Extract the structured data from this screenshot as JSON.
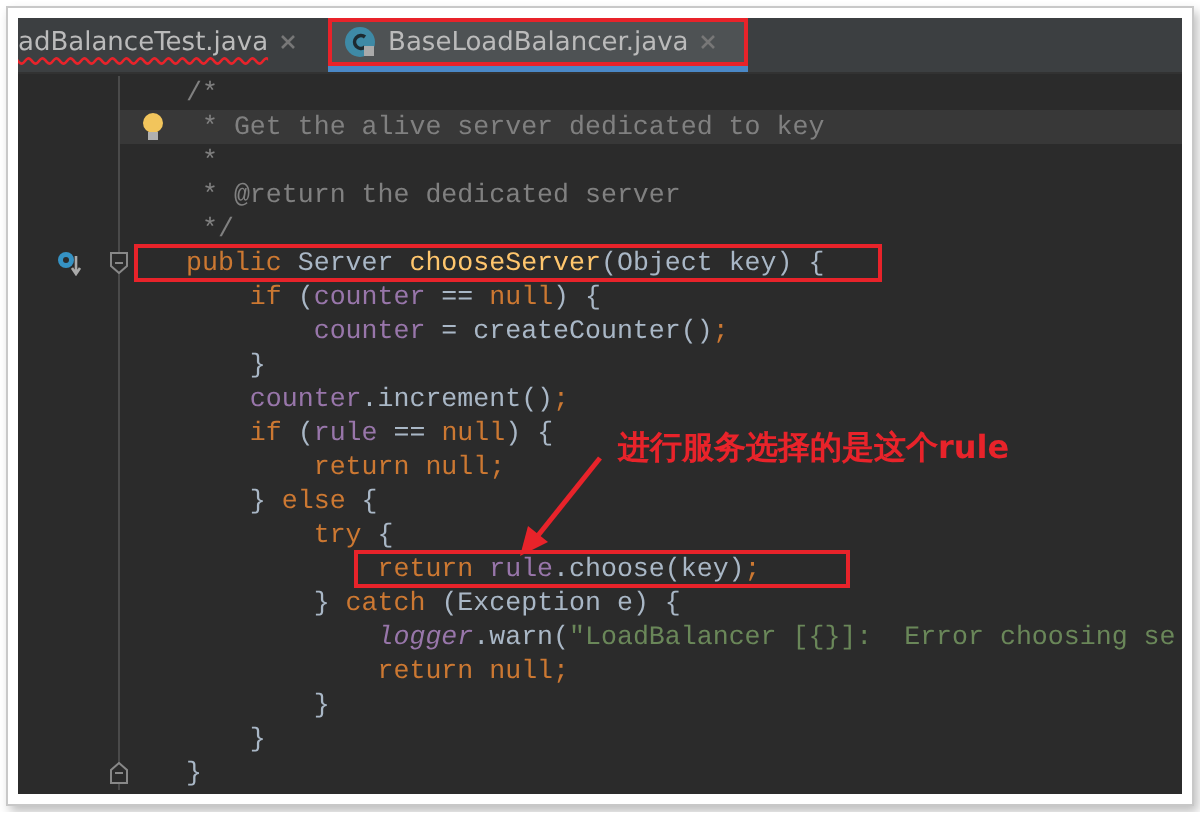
{
  "tabs": [
    {
      "label": "adBalanceTest.java",
      "selected": false,
      "error": true,
      "boxed": false
    },
    {
      "label": "BaseLoadBalancer.java",
      "selected": true,
      "error": false,
      "boxed": true
    }
  ],
  "code": [
    {
      "current": false,
      "boxed": false,
      "tokens": [
        {
          "kind": "comment",
          "text": "/*"
        }
      ]
    },
    {
      "icons": [
        {
          "kind": "bulb"
        }
      ],
      "current": true,
      "boxed": false,
      "tokens": [
        {
          "kind": "comment",
          "text": " * Get the alive server dedicated to key"
        }
      ]
    },
    {
      "current": false,
      "boxed": false,
      "tokens": [
        {
          "kind": "comment",
          "text": " *"
        }
      ]
    },
    {
      "current": false,
      "boxed": false,
      "tokens": [
        {
          "kind": "comment",
          "text": " * @return the dedicated server"
        }
      ]
    },
    {
      "current": false,
      "boxed": false,
      "tokens": [
        {
          "kind": "comment",
          "text": " */"
        }
      ]
    },
    {
      "icons": [
        {
          "kind": "override"
        },
        {
          "kind": "fold_start"
        }
      ],
      "current": false,
      "boxed": true,
      "tokens": [
        {
          "kind": "keyword",
          "text": "public "
        },
        {
          "kind": "plain",
          "text": "Server "
        },
        {
          "kind": "method",
          "text": "chooseServer"
        },
        {
          "kind": "plain",
          "text": "(Object key) {"
        }
      ]
    },
    {
      "current": false,
      "boxed": false,
      "tokens": [
        {
          "kind": "keyword",
          "text": "    if "
        },
        {
          "kind": "plain",
          "text": "("
        },
        {
          "kind": "field",
          "text": "counter"
        },
        {
          "kind": "plain",
          "text": " == "
        },
        {
          "kind": "keyword",
          "text": "null"
        },
        {
          "kind": "plain",
          "text": ") {"
        }
      ]
    },
    {
      "current": false,
      "boxed": false,
      "tokens": [
        {
          "kind": "field",
          "text": "        counter"
        },
        {
          "kind": "plain",
          "text": " = createCounter()"
        },
        {
          "kind": "keyword",
          "text": ";"
        }
      ]
    },
    {
      "current": false,
      "boxed": false,
      "tokens": [
        {
          "kind": "plain",
          "text": "    }"
        }
      ]
    },
    {
      "current": false,
      "boxed": false,
      "tokens": [
        {
          "kind": "field",
          "text": "    counter"
        },
        {
          "kind": "plain",
          "text": ".increment()"
        },
        {
          "kind": "keyword",
          "text": ";"
        }
      ]
    },
    {
      "current": false,
      "boxed": false,
      "tokens": [
        {
          "kind": "keyword",
          "text": "    if "
        },
        {
          "kind": "plain",
          "text": "("
        },
        {
          "kind": "field",
          "text": "rule"
        },
        {
          "kind": "plain",
          "text": " == "
        },
        {
          "kind": "keyword",
          "text": "null"
        },
        {
          "kind": "plain",
          "text": ") {"
        }
      ]
    },
    {
      "current": false,
      "boxed": false,
      "tokens": [
        {
          "kind": "keyword",
          "text": "        return null;"
        }
      ]
    },
    {
      "current": false,
      "boxed": false,
      "tokens": [
        {
          "kind": "plain",
          "text": "    } "
        },
        {
          "kind": "keyword",
          "text": "else "
        },
        {
          "kind": "plain",
          "text": "{"
        }
      ]
    },
    {
      "current": false,
      "boxed": false,
      "tokens": [
        {
          "kind": "keyword",
          "text": "        try "
        },
        {
          "kind": "plain",
          "text": "{"
        }
      ]
    },
    {
      "current": false,
      "boxed": true,
      "tokens": [
        {
          "kind": "keyword",
          "text": "            return "
        },
        {
          "kind": "field",
          "text": "rule"
        },
        {
          "kind": "plain",
          "text": ".choose(key)"
        },
        {
          "kind": "keyword",
          "text": ";"
        }
      ]
    },
    {
      "current": false,
      "boxed": false,
      "tokens": [
        {
          "kind": "plain",
          "text": "        } "
        },
        {
          "kind": "keyword",
          "text": "catch "
        },
        {
          "kind": "plain",
          "text": "(Exception e) {"
        }
      ]
    },
    {
      "current": false,
      "boxed": false,
      "tokens": [
        {
          "kind": "static",
          "text": "            logger"
        },
        {
          "kind": "plain",
          "text": ".warn("
        },
        {
          "kind": "string",
          "text": "\"LoadBalancer [{}]:  Error choosing se"
        }
      ]
    },
    {
      "current": false,
      "boxed": false,
      "tokens": [
        {
          "kind": "keyword",
          "text": "            return null;"
        }
      ]
    },
    {
      "current": false,
      "boxed": false,
      "tokens": [
        {
          "kind": "plain",
          "text": "        }"
        }
      ]
    },
    {
      "current": false,
      "boxed": false,
      "tokens": [
        {
          "kind": "plain",
          "text": "    }"
        }
      ]
    },
    {
      "icons": [
        {
          "kind": "fold_end"
        }
      ],
      "current": false,
      "boxed": false,
      "tokens": [
        {
          "kind": "plain",
          "text": "}"
        }
      ]
    }
  ],
  "callout": {
    "text": "进行服务选择的是这个rule"
  }
}
